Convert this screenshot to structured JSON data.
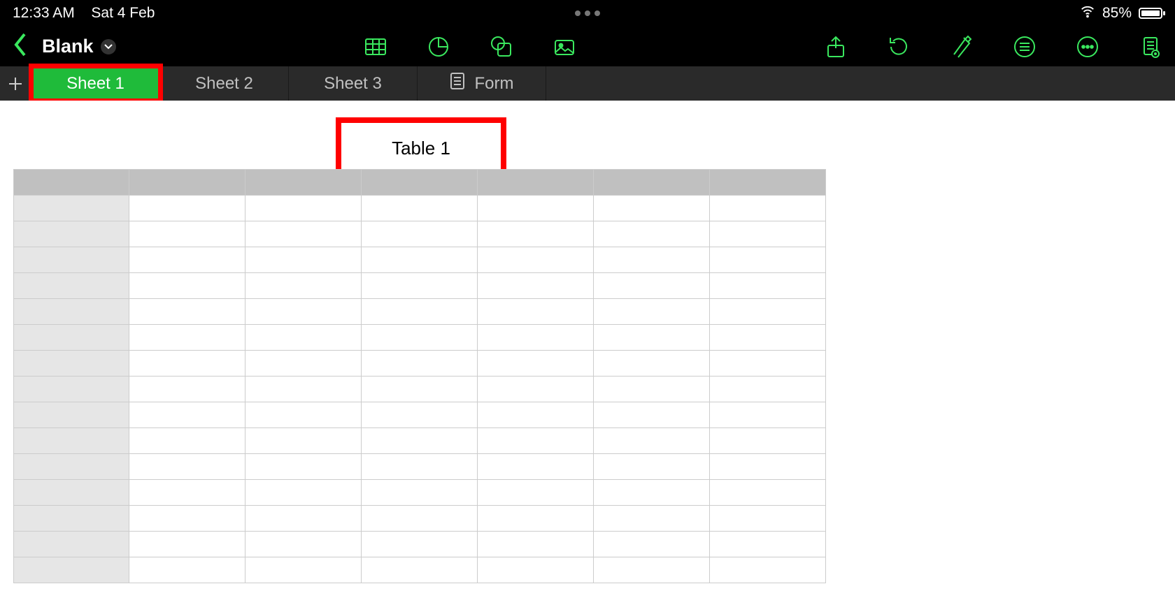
{
  "status": {
    "time": "12:33 AM",
    "date": "Sat 4 Feb",
    "battery_pct": "85%"
  },
  "toolbar": {
    "back": "‹",
    "title": "Blank",
    "icons": [
      "table-icon",
      "chart-icon",
      "shape-icon",
      "media-icon",
      "share-icon",
      "undo-icon",
      "format-icon",
      "list-menu",
      "more-icon",
      "document-settings-icon"
    ]
  },
  "sheets": {
    "tabs": [
      {
        "label": "Sheet 1",
        "active": true
      },
      {
        "label": "Sheet 2"
      },
      {
        "label": "Sheet 3"
      }
    ],
    "form_tab_label": "Form"
  },
  "table": {
    "title": "Table 1",
    "columns": 7,
    "rows": 15
  }
}
